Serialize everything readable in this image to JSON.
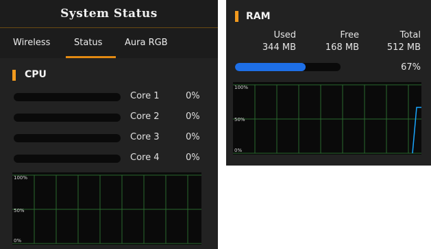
{
  "header": {
    "title": "System Status"
  },
  "tabs": [
    {
      "label": "Wireless"
    },
    {
      "label": "Status"
    },
    {
      "label": "Aura RGB"
    }
  ],
  "cpu": {
    "title": "CPU",
    "cores": [
      {
        "label": "Core 1",
        "percent": "0%",
        "usage": 0
      },
      {
        "label": "Core 2",
        "percent": "0%",
        "usage": 0
      },
      {
        "label": "Core 3",
        "percent": "0%",
        "usage": 0
      },
      {
        "label": "Core 4",
        "percent": "0%",
        "usage": 0
      }
    ],
    "graph": {
      "tick_top": "100%",
      "tick_mid": "50%",
      "tick_bottom": "0%"
    }
  },
  "ram": {
    "title": "RAM",
    "used_label": "Used",
    "free_label": "Free",
    "total_label": "Total",
    "used_value": "344 MB",
    "free_value": "168 MB",
    "total_value": "512 MB",
    "percent": "67%",
    "usage": 0.67,
    "graph": {
      "tick_top": "100%",
      "tick_mid": "50%",
      "tick_bottom": "0%"
    }
  },
  "colors": {
    "accent": "#f29a1e",
    "tab_underline": "#e48a12",
    "gridline": "#2a6a2e",
    "ram_fill": "#1e6fe6",
    "ram_line": "#19a6ff"
  }
}
